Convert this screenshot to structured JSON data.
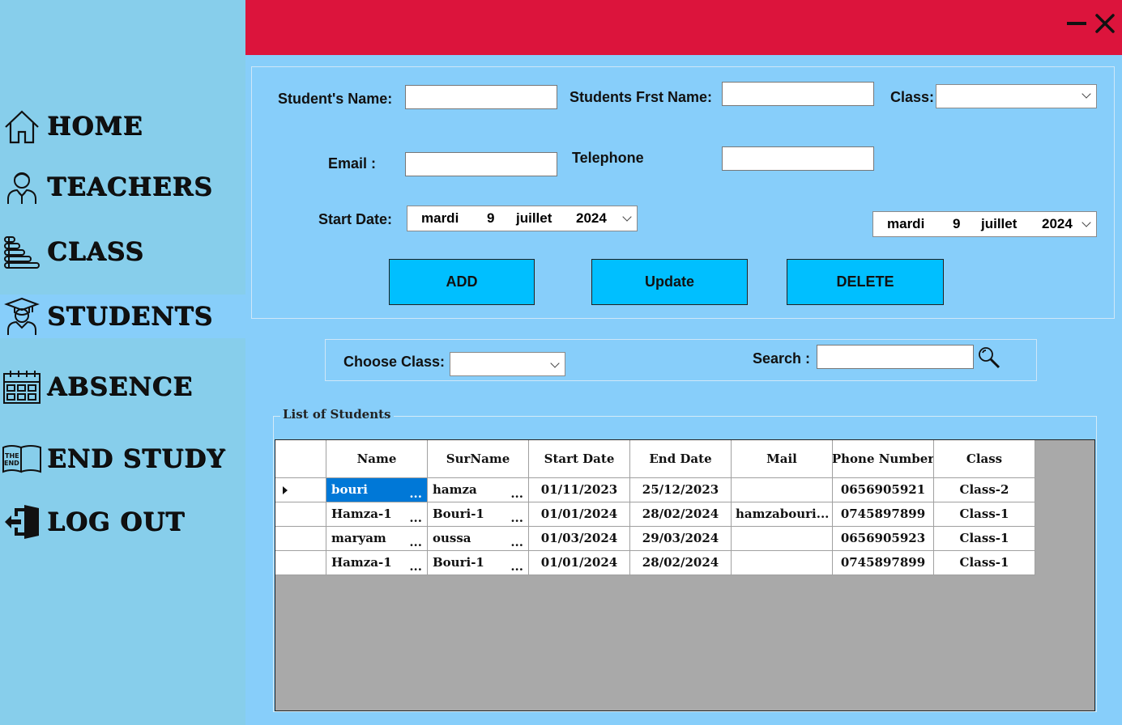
{
  "sidebar": {
    "items": [
      {
        "label": "HOME",
        "icon": "home-icon"
      },
      {
        "label": "TEACHERS",
        "icon": "teacher-icon"
      },
      {
        "label": "CLASS",
        "icon": "books-icon"
      },
      {
        "label": "STUDENTS",
        "icon": "student-icon"
      },
      {
        "label": "ABSENCE",
        "icon": "calendar-icon"
      },
      {
        "label": "END STUDY",
        "icon": "the-end-book-icon"
      },
      {
        "label": "LOG OUT",
        "icon": "logout-icon"
      }
    ],
    "active": "STUDENTS"
  },
  "titlebar": {
    "accent": "#DC143C",
    "minimize_icon": "minimize-icon",
    "close_icon": "close-icon"
  },
  "form": {
    "student_name_label": "Student's Name:",
    "student_name_value": "",
    "first_name_label": "Students Frst Name:",
    "first_name_value": "",
    "class_label": "Class:",
    "class_value": "",
    "email_label": "Email :",
    "email_value": "",
    "telephone_label": "Telephone",
    "telephone_value": "",
    "start_date_label": "Start Date:",
    "start_date": {
      "weekday": "mardi",
      "day": "9",
      "month": "juillet",
      "year": "2024"
    },
    "end_date": {
      "weekday": "mardi",
      "day": "9",
      "month": "juillet",
      "year": "2024"
    },
    "add_label": "ADD",
    "update_label": "Update",
    "delete_label": "DELETE"
  },
  "filter": {
    "choose_class_label": "Choose Class:",
    "choose_class_value": "",
    "search_label": "Search :",
    "search_value": ""
  },
  "list": {
    "title": "List of Students",
    "headers": [
      "Name",
      "SurName",
      "Start Date",
      "End Date",
      "Mail",
      "Phone Number",
      "Class"
    ],
    "rows": [
      {
        "name": "bouri",
        "surname": "hamza",
        "start": "01/11/2023",
        "end": "25/12/2023",
        "mail": "",
        "phone": "0656905921",
        "class": "Class-2",
        "selected": true
      },
      {
        "name": "Hamza-1",
        "surname": "Bouri-1",
        "start": "01/01/2024",
        "end": "28/02/2024",
        "mail": "hamzabouri...",
        "phone": "0745897899",
        "class": "Class-1"
      },
      {
        "name": "maryam",
        "surname": "oussa",
        "start": "01/03/2024",
        "end": "29/03/2024",
        "mail": "",
        "phone": "0656905923",
        "class": "Class-1"
      },
      {
        "name": "Hamza-1",
        "surname": "Bouri-1",
        "start": "01/01/2024",
        "end": "28/02/2024",
        "mail": "",
        "phone": "0745897899",
        "class": "Class-1"
      }
    ],
    "ellipsis": "..."
  },
  "colors": {
    "sidebar": "#87CEEB",
    "main": "#87CEFA",
    "button": "#00BFFF",
    "selection": "#0078D7",
    "grid_empty": "#A9A9A9"
  }
}
